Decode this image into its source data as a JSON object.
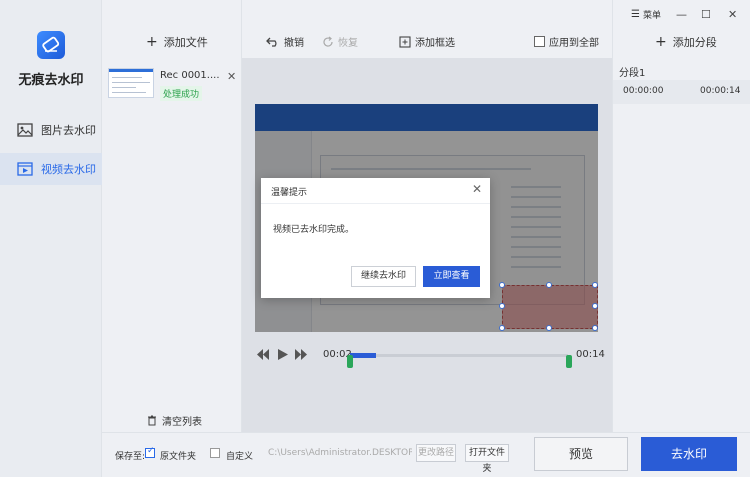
{
  "app": {
    "title": "无痕去水印"
  },
  "window": {
    "menu_label": "菜单",
    "minimize": "—",
    "maximize": "☐",
    "close": "✕"
  },
  "nav": {
    "items": [
      {
        "label": "图片去水印",
        "icon": "image-icon",
        "active": false
      },
      {
        "label": "视频去水印",
        "icon": "video-icon",
        "active": true
      }
    ]
  },
  "files": {
    "add_label": "添加文件",
    "items": [
      {
        "name": "Rec 0001....",
        "status": "处理成功"
      }
    ],
    "clear_label": "清空列表"
  },
  "toolbar": {
    "undo": "撤销",
    "redo": "恢复",
    "add_box": "添加框选",
    "apply_all": "应用到全部"
  },
  "player": {
    "current_time": "00:02",
    "end_time": "00:14",
    "progress": 0.12
  },
  "segments": {
    "add_label": "添加分段",
    "items": [
      {
        "title": "分段1",
        "start": "00:00:00",
        "end": "00:00:14"
      }
    ]
  },
  "bottom": {
    "save_to_label": "保存至:",
    "option_source": "原文件夹",
    "option_custom": "自定义",
    "path": "C:\\Users\\Administrator.DESKTOP-KM",
    "change_path": "更改路径",
    "open_folder": "打开文件夹",
    "preview": "预览",
    "remove": "去水印"
  },
  "dialog": {
    "title": "温馨提示",
    "message": "视频已去水印完成。",
    "continue_label": "继续去水印",
    "view_label": "立即查看"
  },
  "colors": {
    "accent": "#2a5cd6",
    "success": "#2aa14a",
    "marker": "#2aa65a"
  }
}
